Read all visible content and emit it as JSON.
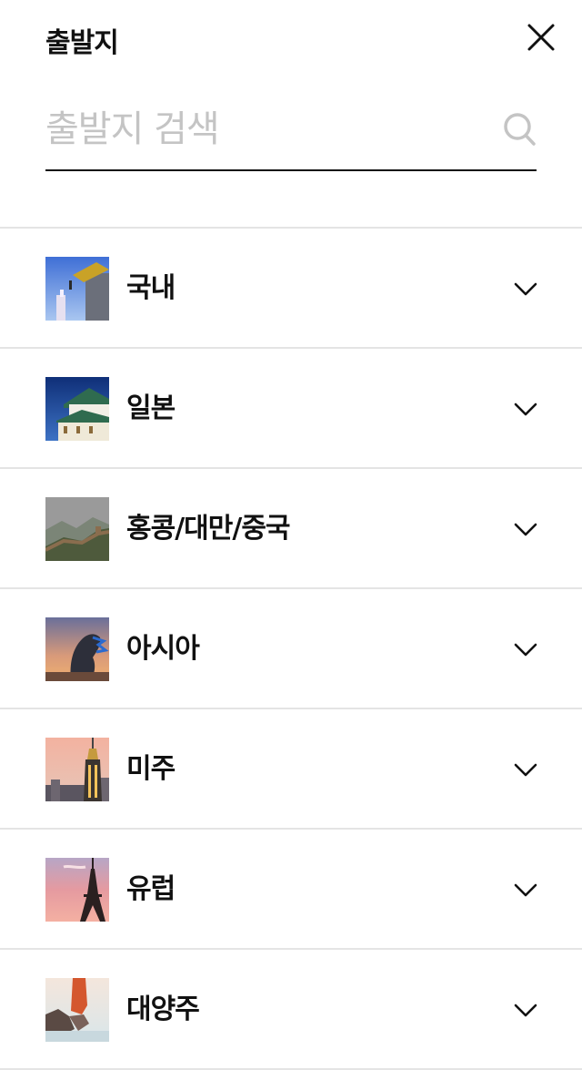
{
  "header": {
    "title": "출발지",
    "close_icon": "close-icon"
  },
  "search": {
    "placeholder": "출발지 검색",
    "value": "",
    "icon": "search-icon"
  },
  "regions": [
    {
      "label": "국내",
      "icon": "chevron-down-icon"
    },
    {
      "label": "일본",
      "icon": "chevron-down-icon"
    },
    {
      "label": "홍콩/대만/중국",
      "icon": "chevron-down-icon"
    },
    {
      "label": "아시아",
      "icon": "chevron-down-icon"
    },
    {
      "label": "미주",
      "icon": "chevron-down-icon"
    },
    {
      "label": "유럽",
      "icon": "chevron-down-icon"
    },
    {
      "label": "대양주",
      "icon": "chevron-down-icon"
    }
  ]
}
